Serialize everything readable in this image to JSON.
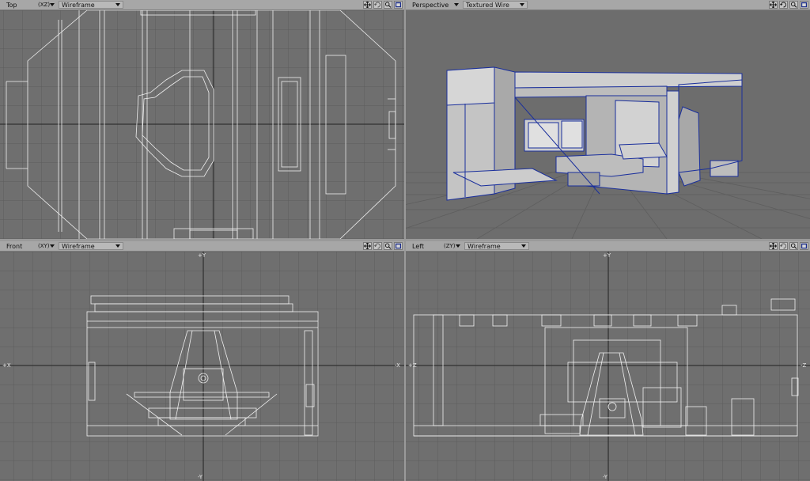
{
  "viewports": {
    "top": {
      "name": "Top",
      "axes": "(XZ)",
      "mode": "Wireframe"
    },
    "perspective": {
      "name": "Perspective",
      "axes": "",
      "mode": "Textured Wire"
    },
    "front": {
      "name": "Front",
      "axes": "(XY)",
      "mode": "Wireframe",
      "labels": {
        "pos_y": "+Y",
        "neg_y": "-Y",
        "pos_x": "+X",
        "neg_x": "-X"
      }
    },
    "left": {
      "name": "Left",
      "axes": "(ZY)",
      "mode": "Wireframe",
      "labels": {
        "pos_y": "+Y",
        "neg_y": "-Y",
        "pos_z": "+Z",
        "neg_z": "-Z"
      }
    }
  },
  "controls": [
    "move-icon",
    "rotate-icon",
    "zoom-icon",
    "maximize-icon"
  ],
  "colors": {
    "viewport_bg": "#6f6f6f",
    "grid": "#5b5b5b",
    "wire": "#f2f2f2",
    "persp_wire": "#1a2f9c",
    "header": "#a7a7a7"
  }
}
